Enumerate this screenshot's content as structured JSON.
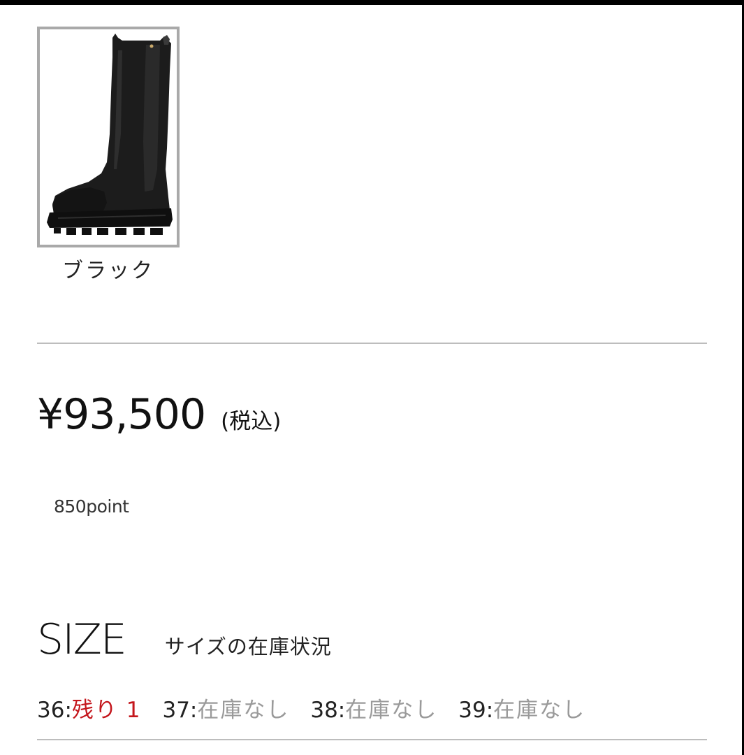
{
  "variant": {
    "color_label": "ブラック",
    "image_icon": "black-chelsea-boot-image"
  },
  "price": {
    "amount": "¥93,500",
    "tax_note": "(税込)"
  },
  "points": {
    "label": "850point"
  },
  "size_section": {
    "title": "SIZE",
    "subtitle": "サイズの在庫状況",
    "items": [
      {
        "size": "36:",
        "status": "残り 1",
        "state": "available"
      },
      {
        "size": "37:",
        "status": "在庫なし",
        "state": "soldout"
      },
      {
        "size": "38:",
        "status": "在庫なし",
        "state": "soldout"
      },
      {
        "size": "39:",
        "status": "在庫なし",
        "state": "soldout"
      }
    ]
  },
  "colors": {
    "available": "#c4161c",
    "soldout": "#9a9a9a",
    "divider": "#bdbdbd",
    "swatch_border": "#a9a9a9"
  }
}
